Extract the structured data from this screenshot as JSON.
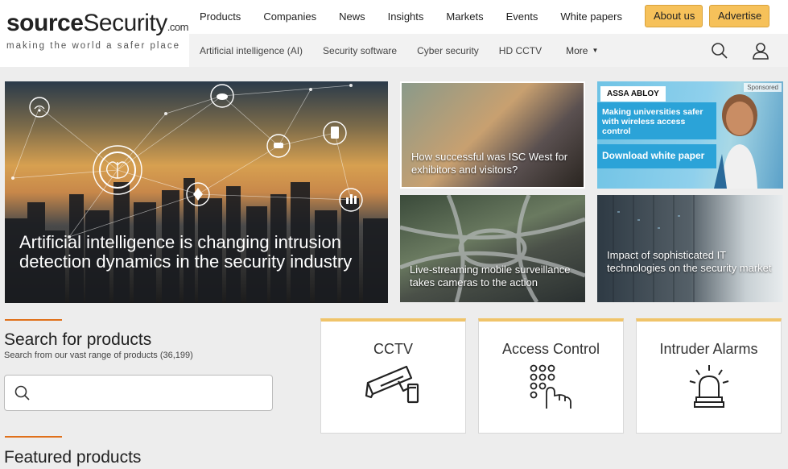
{
  "brand": {
    "logo_bold": "source",
    "logo_rest": "Security",
    "logo_suffix": ".com",
    "tagline": "making the world a safer place",
    "accent_color": "#e0701a"
  },
  "main_nav": [
    "Products",
    "Companies",
    "News",
    "Insights",
    "Markets",
    "Events",
    "White papers"
  ],
  "header_buttons": {
    "about": "About us",
    "advertise": "Advertise"
  },
  "sub_nav": [
    "Artificial intelligence (AI)",
    "Security software",
    "Cyber security",
    "HD CCTV"
  ],
  "sub_nav_more": "More",
  "icons": {
    "search": "search-icon",
    "user": "user-icon"
  },
  "hero": {
    "title": "Artificial intelligence is changing intrusion detection dynamics in the security industry"
  },
  "tiles": {
    "t1": "How successful was ISC West for exhibitors and visitors?",
    "t2": "Live-streaming mobile surveillance takes cameras to the action",
    "t4": "Impact of sophisticated IT technologies on the security market"
  },
  "ad": {
    "brand": "ASSA ABLOY",
    "sponsored": "Sponsored",
    "headline": "Making universities safer with wireless access control",
    "cta": "Download white paper"
  },
  "search": {
    "heading": "Search for products",
    "subtitle": "Search from our vast range of products (36,199)",
    "placeholder": ""
  },
  "product_cards": [
    "CCTV",
    "Access Control",
    "Intruder Alarms"
  ],
  "featured_heading": "Featured products"
}
